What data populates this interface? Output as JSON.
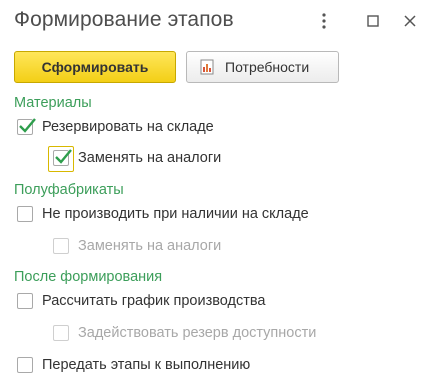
{
  "window": {
    "title": "Формирование этапов"
  },
  "toolbar": {
    "form_label": "Сформировать",
    "needs_label": "Потребности"
  },
  "materials": {
    "header": "Материалы",
    "reserve": {
      "label": "Резервировать на складе",
      "checked": true
    },
    "replace": {
      "label": "Заменять на аналоги",
      "checked": true
    }
  },
  "semi": {
    "header": "Полуфабрикаты",
    "no_produce": {
      "label": "Не производить при наличии на складе",
      "checked": false
    },
    "replace": {
      "label": "Заменять на аналоги",
      "checked": false,
      "disabled": true
    }
  },
  "after": {
    "header": "После формирования",
    "schedule": {
      "label": "Рассчитать график производства",
      "checked": false
    },
    "use_reserve": {
      "label": "Задействовать резерв доступности",
      "checked": false,
      "disabled": true
    },
    "transfer": {
      "label": "Передать этапы к выполнению",
      "checked": false
    }
  },
  "colors": {
    "accent": "#f3cf16",
    "group": "#3c9e5a",
    "check": "#2e9e4c"
  }
}
